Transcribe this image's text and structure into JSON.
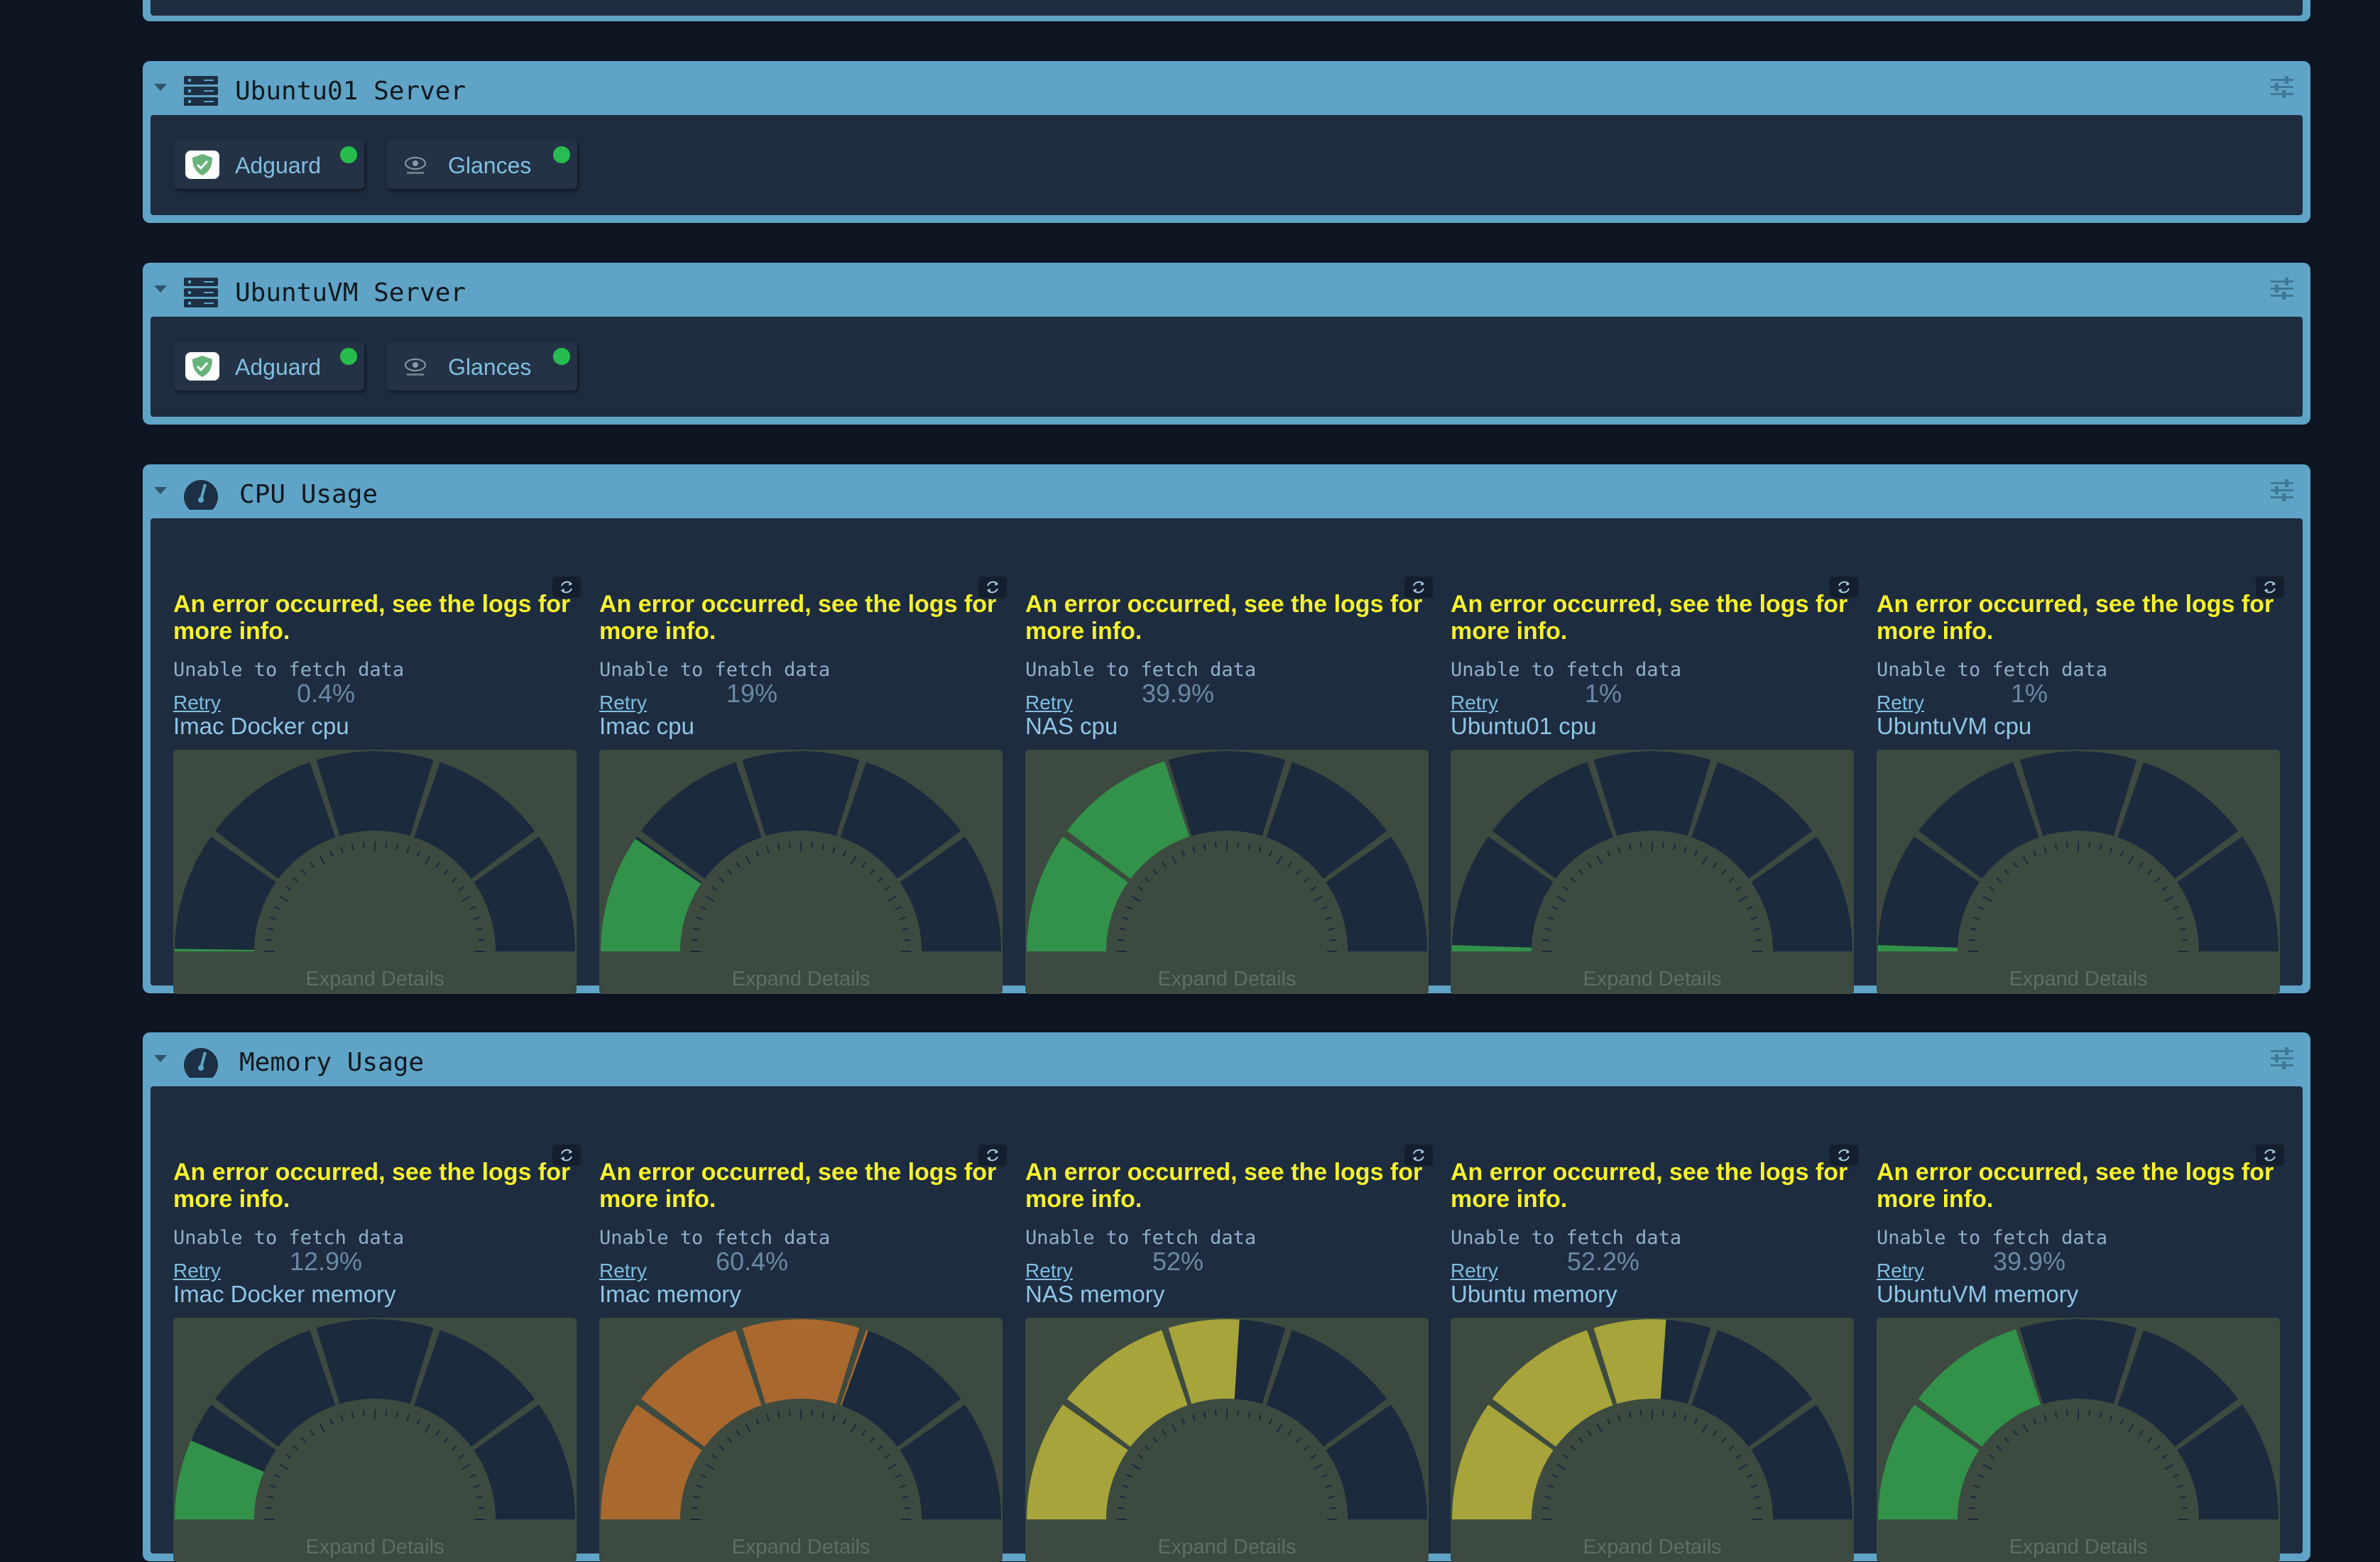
{
  "colors": {
    "page_bg": "#0d1422",
    "section_frame": "#5fa4c6",
    "section_body": "#1e2c40",
    "error_text": "#f7f22a",
    "status_online": "#27bd4e",
    "gauge_bg": "#3d4a40",
    "gauge_segment": "#1c2a3e"
  },
  "sections": [
    {
      "title": "Ubuntu01 Server",
      "icon": "server-icon",
      "apps": [
        {
          "label": "Adguard",
          "icon": "adguard-icon",
          "status": "online"
        },
        {
          "label": "Glances",
          "icon": "glances-icon",
          "status": "online"
        }
      ]
    },
    {
      "title": "UbuntuVM Server",
      "icon": "server-icon",
      "apps": [
        {
          "label": "Adguard",
          "icon": "adguard-icon",
          "status": "online"
        },
        {
          "label": "Glances",
          "icon": "glances-icon",
          "status": "online"
        }
      ]
    },
    {
      "title": "CPU Usage",
      "icon": "gauge-icon",
      "widgets": [
        {
          "error": "An error occurred, see the logs for more info.",
          "unable": "Unable to fetch data",
          "retry": "Retry",
          "value": "0.4%",
          "percent": 0.4,
          "name": "Imac Docker cpu",
          "fill_color": "#32924a",
          "expand": "Expand Details"
        },
        {
          "error": "An error occurred, see the logs for more info.",
          "unable": "Unable to fetch data",
          "retry": "Retry",
          "value": "19%",
          "percent": 19,
          "name": "Imac cpu",
          "fill_color": "#32924a",
          "expand": "Expand Details"
        },
        {
          "error": "An error occurred, see the logs for more info.",
          "unable": "Unable to fetch data",
          "retry": "Retry",
          "value": "39.9%",
          "percent": 39.9,
          "name": "NAS cpu",
          "fill_color": "#32924a",
          "expand": "Expand Details"
        },
        {
          "error": "An error occurred, see the logs for more info.",
          "unable": "Unable to fetch data",
          "retry": "Retry",
          "value": "1%",
          "percent": 1,
          "name": "Ubuntu01 cpu",
          "fill_color": "#32924a",
          "expand": "Expand Details"
        },
        {
          "error": "An error occurred, see the logs for more info.",
          "unable": "Unable to fetch data",
          "retry": "Retry",
          "value": "1%",
          "percent": 1,
          "name": "UbuntuVM cpu",
          "fill_color": "#32924a",
          "expand": "Expand Details"
        }
      ]
    },
    {
      "title": "Memory Usage",
      "icon": "gauge-icon",
      "widgets": [
        {
          "error": "An error occurred, see the logs for more info.",
          "unable": "Unable to fetch data",
          "retry": "Retry",
          "value": "12.9%",
          "percent": 12.9,
          "name": "Imac Docker memory",
          "fill_color": "#32924a",
          "expand": "Expand Details"
        },
        {
          "error": "An error occurred, see the logs for more info.",
          "unable": "Unable to fetch data",
          "retry": "Retry",
          "value": "60.4%",
          "percent": 60.4,
          "name": "Imac memory",
          "fill_color": "#a8682e",
          "expand": "Expand Details"
        },
        {
          "error": "An error occurred, see the logs for more info.",
          "unable": "Unable to fetch data",
          "retry": "Retry",
          "value": "52%",
          "percent": 52,
          "name": "NAS memory",
          "fill_color": "#a6a43a",
          "expand": "Expand Details"
        },
        {
          "error": "An error occurred, see the logs for more info.",
          "unable": "Unable to fetch data",
          "retry": "Retry",
          "value": "52.2%",
          "percent": 52.2,
          "name": "Ubuntu memory",
          "fill_color": "#a6a43a",
          "expand": "Expand Details"
        },
        {
          "error": "An error occurred, see the logs for more info.",
          "unable": "Unable to fetch data",
          "retry": "Retry",
          "value": "39.9%",
          "percent": 39.9,
          "name": "UbuntuVM memory",
          "fill_color": "#32924a",
          "expand": "Expand Details"
        }
      ]
    }
  ]
}
